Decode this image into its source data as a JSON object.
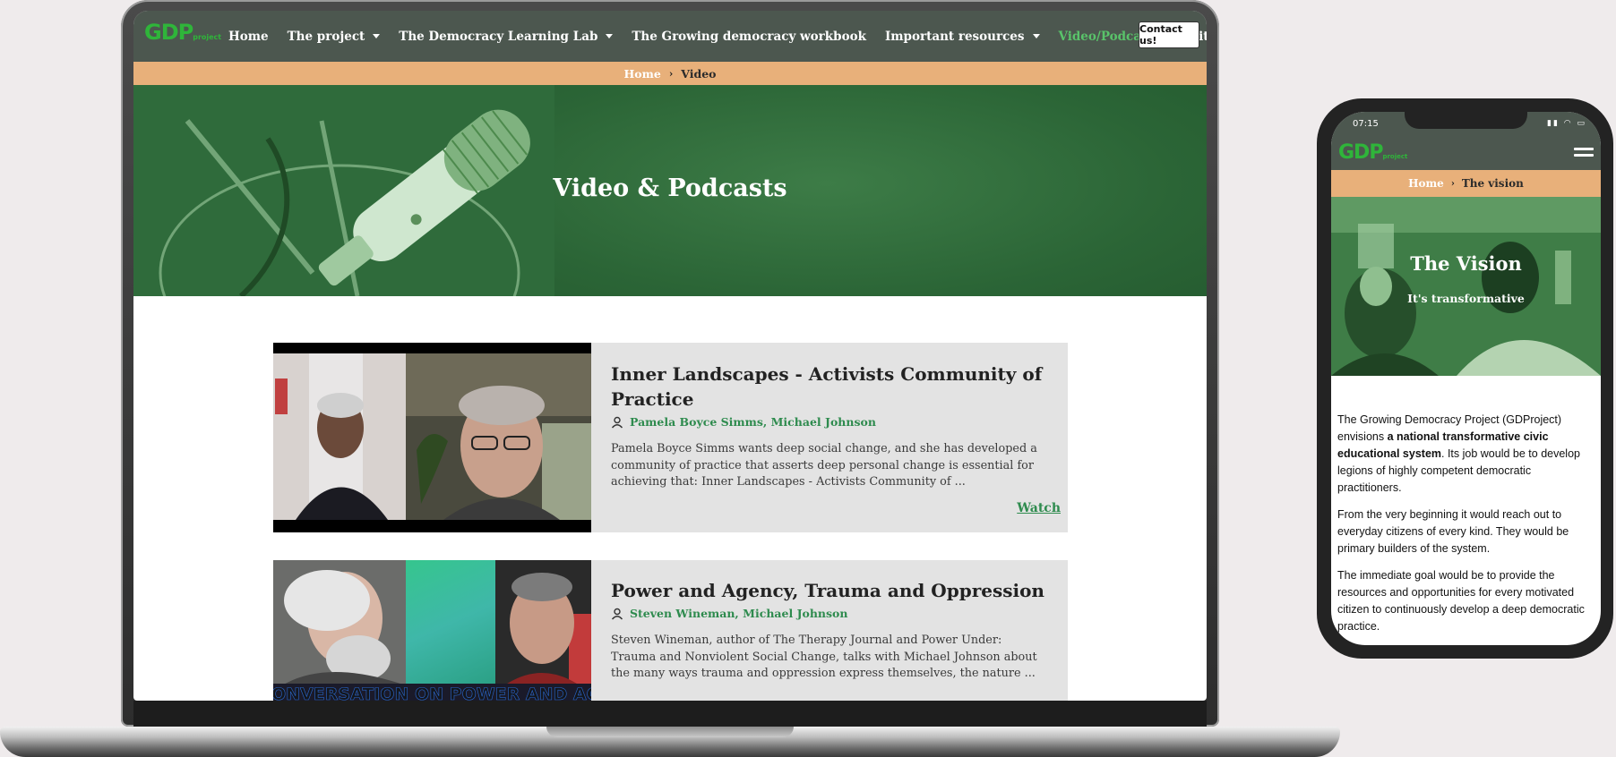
{
  "desktop": {
    "logo": {
      "main": "GDP",
      "sub": "project"
    },
    "nav": [
      {
        "label": "Home",
        "dropdown": false,
        "active": false
      },
      {
        "label": "The project",
        "dropdown": true,
        "active": false
      },
      {
        "label": "The Democracy Learning Lab",
        "dropdown": true,
        "active": false
      },
      {
        "label": "The Growing democracy workbook",
        "dropdown": false,
        "active": false
      },
      {
        "label": "Important resources",
        "dropdown": true,
        "active": false
      },
      {
        "label": "Video/Podcasts",
        "dropdown": false,
        "active": true
      },
      {
        "label": "Writing",
        "dropdown": false,
        "active": false
      }
    ],
    "contact_label": "Contact us!",
    "breadcrumb": {
      "home": "Home",
      "current": "Video"
    },
    "hero_title": "Video & Podcasts",
    "cards": [
      {
        "title": "Inner Landscapes - Activists Community of Practice",
        "authors": "Pamela Boyce Simms, Michael Johnson",
        "description": "Pamela Boyce Simms wants deep social change, and she has developed a community of practice that asserts deep personal change is essential for achieving that: Inner Landscapes - Activists Community of ...",
        "watch_label": "Watch"
      },
      {
        "title": "Power and Agency, Trauma and Oppression",
        "authors": "Steven Wineman, Michael Johnson",
        "description": "Steven Wineman, author of The Therapy Journal and Power Under: Trauma and Nonviolent Social Change, talks with Michael Johnson about the many ways trauma and oppression express themselves, the nature ...",
        "thumb_caption": "ONVERSATION ON POWER AND AGEN"
      }
    ]
  },
  "mobile": {
    "time": "07:15",
    "logo": {
      "main": "GDP",
      "sub": "project"
    },
    "breadcrumb": {
      "home": "Home",
      "current": "The vision"
    },
    "hero_title": "The Vision",
    "hero_subtitle": "It's transformative",
    "para1_before": "The Growing Democracy Project (GDProject) envisions ",
    "para1_bold": "a national transformative civic educational system",
    "para1_after": ". Its job would be to develop legions of highly competent democratic practitioners.",
    "para2": "From the very beginning it would reach out to everyday citizens of every kind. They would be primary builders of the system.",
    "para3": "The immediate goal would be to provide the resources and opportunities for every motivated citizen to continuously develop a deep democratic practice."
  },
  "colors": {
    "nav_bg": "#4c574f",
    "accent_green": "#2e8b4e",
    "breadcrumb_bg": "#e8b07a",
    "hero_green": "#2f6b3b"
  }
}
